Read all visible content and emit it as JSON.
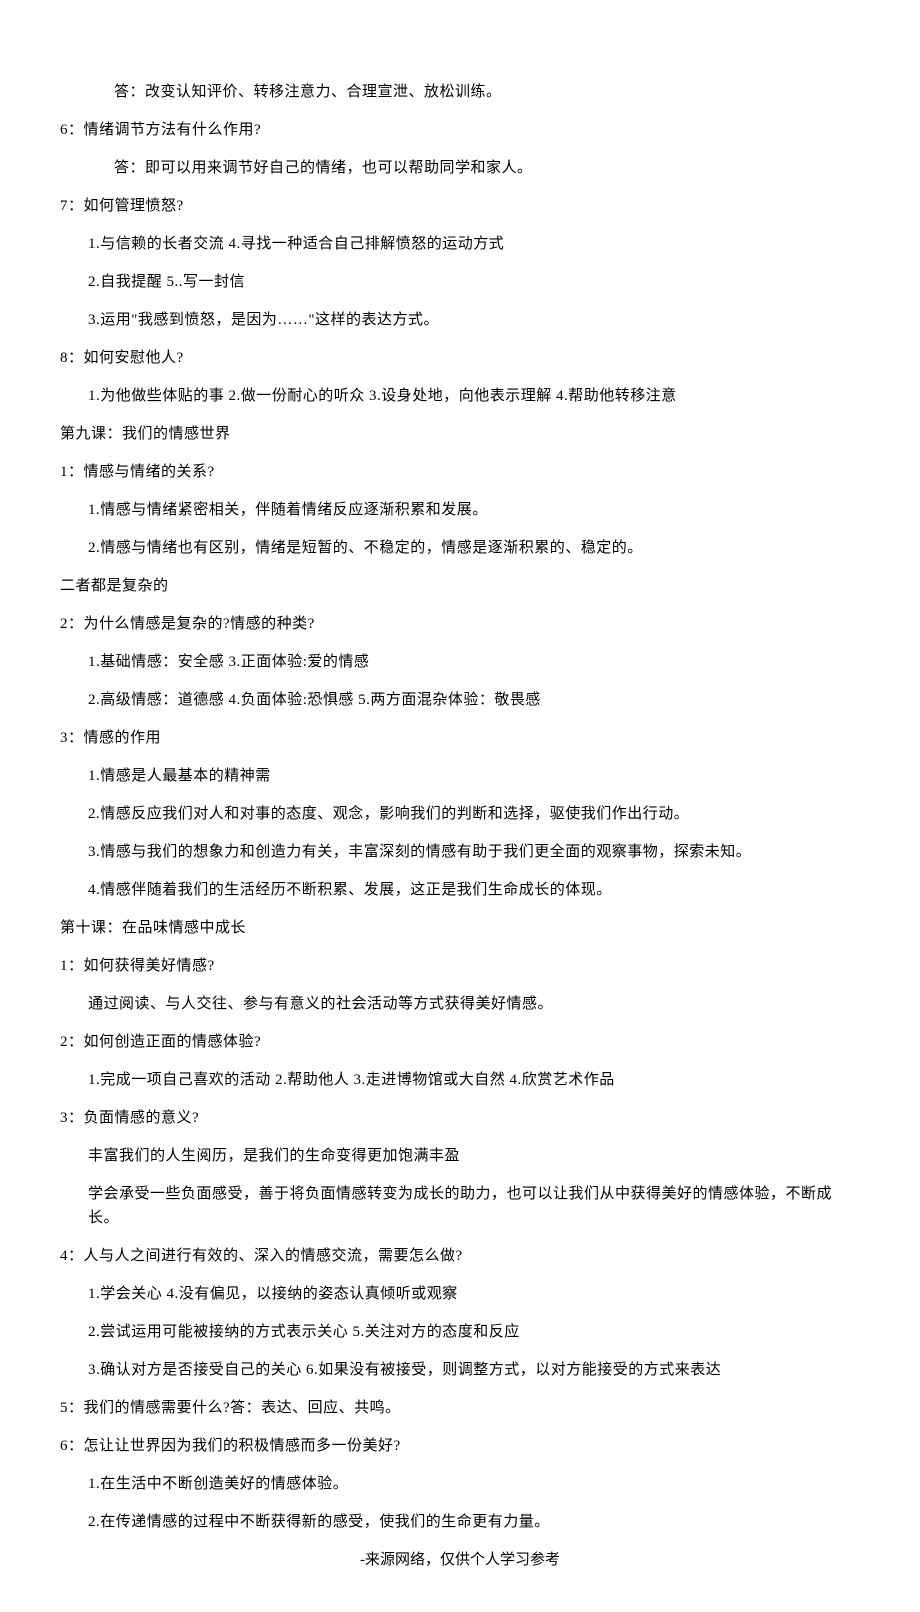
{
  "lines": [
    {
      "indent": 2,
      "text": "答：改变认知评价、转移注意力、合理宣泄、放松训练。"
    },
    {
      "indent": 0,
      "text": "6：情绪调节方法有什么作用?"
    },
    {
      "indent": 2,
      "text": "答：即可以用来调节好自己的情绪，也可以帮助同学和家人。"
    },
    {
      "indent": 0,
      "text": "7：如何管理愤怒?"
    },
    {
      "indent": 1,
      "text": "1.与信赖的长者交流 4.寻找一种适合自己排解愤怒的运动方式"
    },
    {
      "indent": 1,
      "text": "2.自我提醒 5..写一封信"
    },
    {
      "indent": 1,
      "text": "3.运用\"我感到愤怒，是因为……\"这样的表达方式。"
    },
    {
      "indent": 0,
      "text": "8：如何安慰他人?"
    },
    {
      "indent": 1,
      "text": "1.为他做些体贴的事 2.做一份耐心的听众 3.设身处地，向他表示理解 4.帮助他转移注意"
    },
    {
      "indent": 0,
      "text": "第九课：我们的情感世界"
    },
    {
      "indent": 0,
      "text": "1：情感与情绪的关系?"
    },
    {
      "indent": 1,
      "text": "1.情感与情绪紧密相关，伴随着情绪反应逐渐积累和发展。"
    },
    {
      "indent": 1,
      "text": "2.情感与情绪也有区别，情绪是短暂的、不稳定的，情感是逐渐积累的、稳定的。"
    },
    {
      "indent": 0,
      "text": "二者都是复杂的"
    },
    {
      "indent": 0,
      "text": "2：为什么情感是复杂的?情感的种类?"
    },
    {
      "indent": 1,
      "text": "1.基础情感：安全感 3.正面体验:爱的情感"
    },
    {
      "indent": 1,
      "text": "2.高级情感：道德感 4.负面体验:恐惧感 5.两方面混杂体验：敬畏感"
    },
    {
      "indent": 0,
      "text": "3：情感的作用"
    },
    {
      "indent": 1,
      "text": "1.情感是人最基本的精神需"
    },
    {
      "indent": 1,
      "text": "2.情感反应我们对人和对事的态度、观念，影响我们的判断和选择，驱使我们作出行动。"
    },
    {
      "indent": 1,
      "text": "3.情感与我们的想象力和创造力有关，丰富深刻的情感有助于我们更全面的观察事物，探索未知。"
    },
    {
      "indent": 1,
      "text": "4.情感伴随着我们的生活经历不断积累、发展，这正是我们生命成长的体现。"
    },
    {
      "indent": 0,
      "text": "第十课：在品味情感中成长"
    },
    {
      "indent": 0,
      "text": "1：如何获得美好情感?"
    },
    {
      "indent": 1,
      "text": "通过阅读、与人交往、参与有意义的社会活动等方式获得美好情感。"
    },
    {
      "indent": 0,
      "text": "2：如何创造正面的情感体验?"
    },
    {
      "indent": 1,
      "text": "1.完成一项自己喜欢的活动 2.帮助他人 3.走进博物馆或大自然 4.欣赏艺术作品"
    },
    {
      "indent": 0,
      "text": "3：负面情感的意义?"
    },
    {
      "indent": 1,
      "text": "丰富我们的人生阅历，是我们的生命变得更加饱满丰盈"
    },
    {
      "indent": 1,
      "text": "学会承受一些负面感受，善于将负面情感转变为成长的助力，也可以让我们从中获得美好的情感体验，不断成长。"
    },
    {
      "indent": 0,
      "text": "4：人与人之间进行有效的、深入的情感交流，需要怎么做?"
    },
    {
      "indent": 1,
      "text": "1.学会关心 4.没有偏见，以接纳的姿态认真倾听或观察"
    },
    {
      "indent": 1,
      "text": "2.尝试运用可能被接纳的方式表示关心 5.关注对方的态度和反应"
    },
    {
      "indent": 1,
      "text": "3.确认对方是否接受自己的关心 6.如果没有被接受，则调整方式，以对方能接受的方式来表达"
    },
    {
      "indent": 0,
      "text": "5：我们的情感需要什么?答：表达、回应、共鸣。"
    },
    {
      "indent": 0,
      "text": "6：怎让让世界因为我们的积极情感而多一份美好?"
    },
    {
      "indent": 1,
      "text": "1.在生活中不断创造美好的情感体验。"
    },
    {
      "indent": 1,
      "text": "2.在传递情感的过程中不断获得新的感受，使我们的生命更有力量。"
    }
  ],
  "footer": "-来源网络，仅供个人学习参考"
}
